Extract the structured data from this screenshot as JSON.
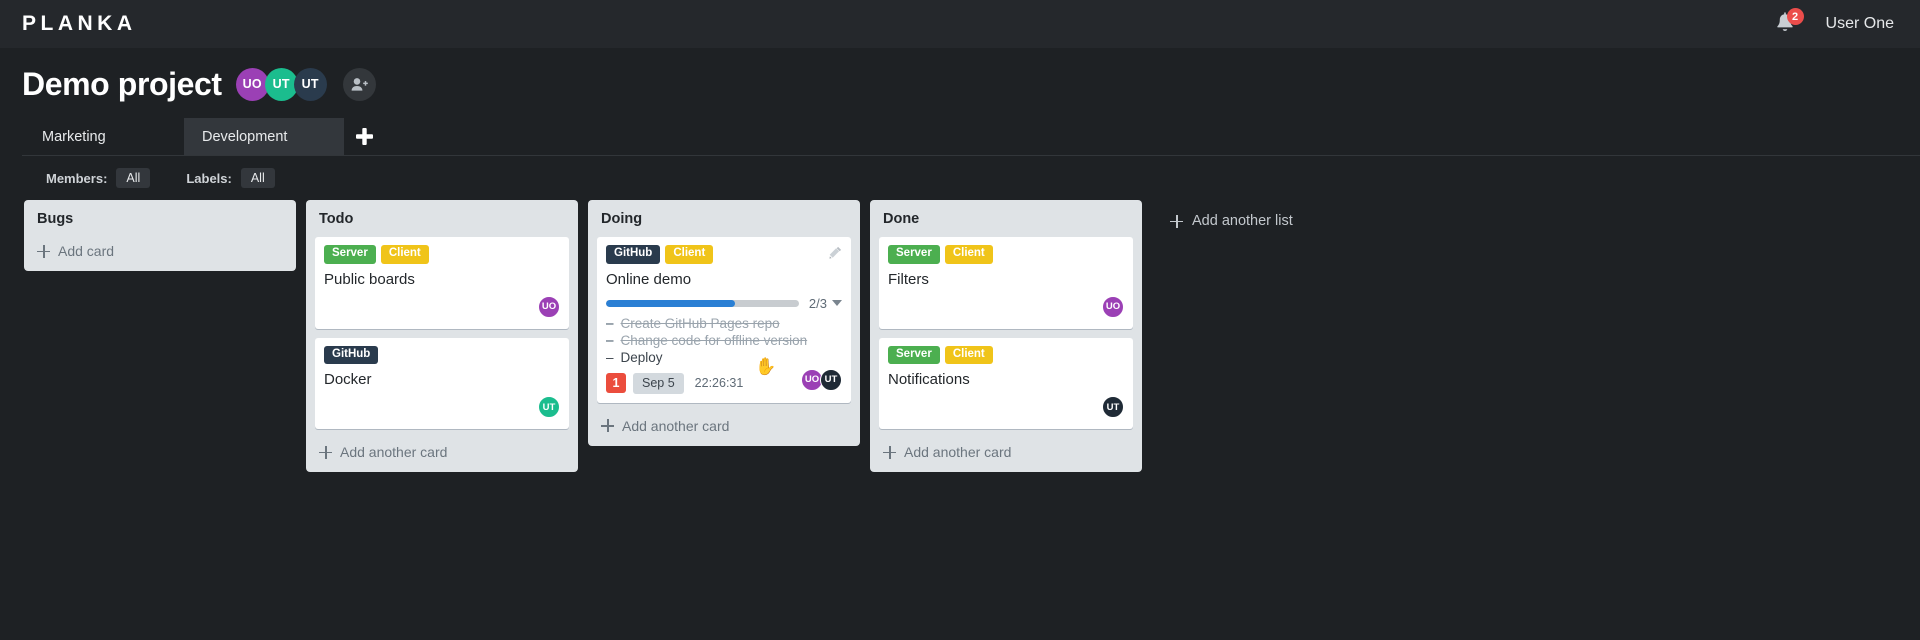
{
  "topbar": {
    "logo": "PLANKA",
    "notifications_count": "2",
    "notifications_icon": "bell-icon",
    "username": "User One"
  },
  "project": {
    "title": "Demo project",
    "members": [
      {
        "initials": "UO",
        "color": "#9b40b5"
      },
      {
        "initials": "UT",
        "color": "#1bbd8e"
      },
      {
        "initials": "UT",
        "color": "#2a3b4d"
      }
    ],
    "add_member_icon": "add-user-icon"
  },
  "tabs": {
    "items": [
      {
        "label": "Marketing",
        "active": false
      },
      {
        "label": "Development",
        "active": true
      }
    ],
    "add_label": "+"
  },
  "filters": {
    "members_label": "Members:",
    "members_value": "All",
    "labels_label": "Labels:",
    "labels_value": "All"
  },
  "board": {
    "add_list_label": "Add another list",
    "add_card_label": "Add card",
    "add_another_card_label": "Add another card",
    "lists": [
      {
        "title": "Bugs",
        "cards": [],
        "add_label": "Add card"
      },
      {
        "title": "Todo",
        "add_label": "Add another card",
        "cards": [
          {
            "name": "Public boards",
            "labels": [
              {
                "text": "Server",
                "color": "#4caf50"
              },
              {
                "text": "Client",
                "color": "#f0c419"
              }
            ],
            "avatars": [
              {
                "initials": "UO",
                "color": "#9b40b5"
              }
            ]
          },
          {
            "name": "Docker",
            "labels": [
              {
                "text": "GitHub",
                "color": "#2a3b4d"
              }
            ],
            "avatars": [
              {
                "initials": "UT",
                "color": "#1bbd8e"
              }
            ]
          }
        ]
      },
      {
        "title": "Doing",
        "add_label": "Add another card",
        "cards": [
          {
            "name": "Online demo",
            "edit_icon": "pencil-icon",
            "labels": [
              {
                "text": "GitHub",
                "color": "#2a3b4d"
              },
              {
                "text": "Client",
                "color": "#f0c419"
              }
            ],
            "progress": {
              "text": "2/3",
              "percent": 66.7,
              "fill_color": "#2a7fd4"
            },
            "tasks": [
              {
                "text": "Create GitHub Pages repo",
                "done": true
              },
              {
                "text": "Change code for offline version",
                "done": true
              },
              {
                "text": "Deploy",
                "done": false
              }
            ],
            "meta": {
              "count_badge": "1",
              "date": "Sep 5",
              "time": "22:26:31"
            },
            "avatars": [
              {
                "initials": "UO",
                "color": "#9b40b5"
              },
              {
                "initials": "UT",
                "color": "#1f2a36"
              }
            ]
          }
        ]
      },
      {
        "title": "Done",
        "add_label": "Add another card",
        "cards": [
          {
            "name": "Filters",
            "labels": [
              {
                "text": "Server",
                "color": "#4caf50"
              },
              {
                "text": "Client",
                "color": "#f0c419"
              }
            ],
            "avatars": [
              {
                "initials": "UO",
                "color": "#9b40b5"
              }
            ]
          },
          {
            "name": "Notifications",
            "labels": [
              {
                "text": "Server",
                "color": "#4caf50"
              },
              {
                "text": "Client",
                "color": "#f0c419"
              }
            ],
            "avatars": [
              {
                "initials": "UT",
                "color": "#1f2a36"
              }
            ]
          }
        ]
      }
    ]
  }
}
